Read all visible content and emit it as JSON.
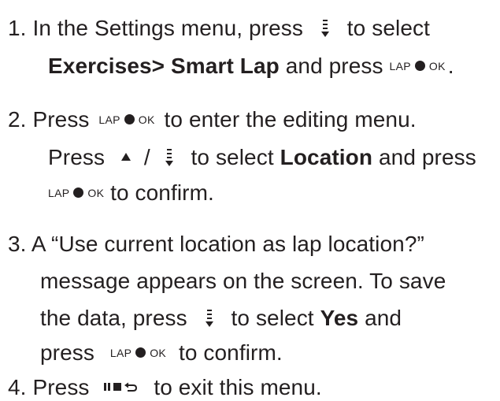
{
  "steps": [
    {
      "number": "1.",
      "text_a": "In the Settings menu, press",
      "text_b": "to select",
      "bold_path": "Exercises> Smart Lap",
      "text_c": "and press",
      "text_d": "."
    },
    {
      "number": "2.",
      "text_a": "Press",
      "text_b": "to enter the editing menu.",
      "line2_a": "Press",
      "line2_sep": "/",
      "line2_b": "to select",
      "bold_item": "Location",
      "line2_c": "and press",
      "line3_a": "to confirm."
    },
    {
      "number": "3.",
      "line1": "A “Use current location as lap location?”",
      "line2": "message appears on the screen. To save",
      "line3_a": "the data, press",
      "line3_b": "to select",
      "bold_item": "Yes",
      "line3_c": "and",
      "line4_a": "press",
      "line4_b": "to confirm."
    },
    {
      "number": "4.",
      "text_a": "Press",
      "text_b": "to exit this menu."
    }
  ],
  "lap_ok_icon": {
    "left_label": "LAP",
    "right_label": "OK"
  },
  "icons": {
    "down_button": "down-button-icon",
    "up_button": "up-button-icon",
    "back_button": "back-stop-button-icon"
  }
}
